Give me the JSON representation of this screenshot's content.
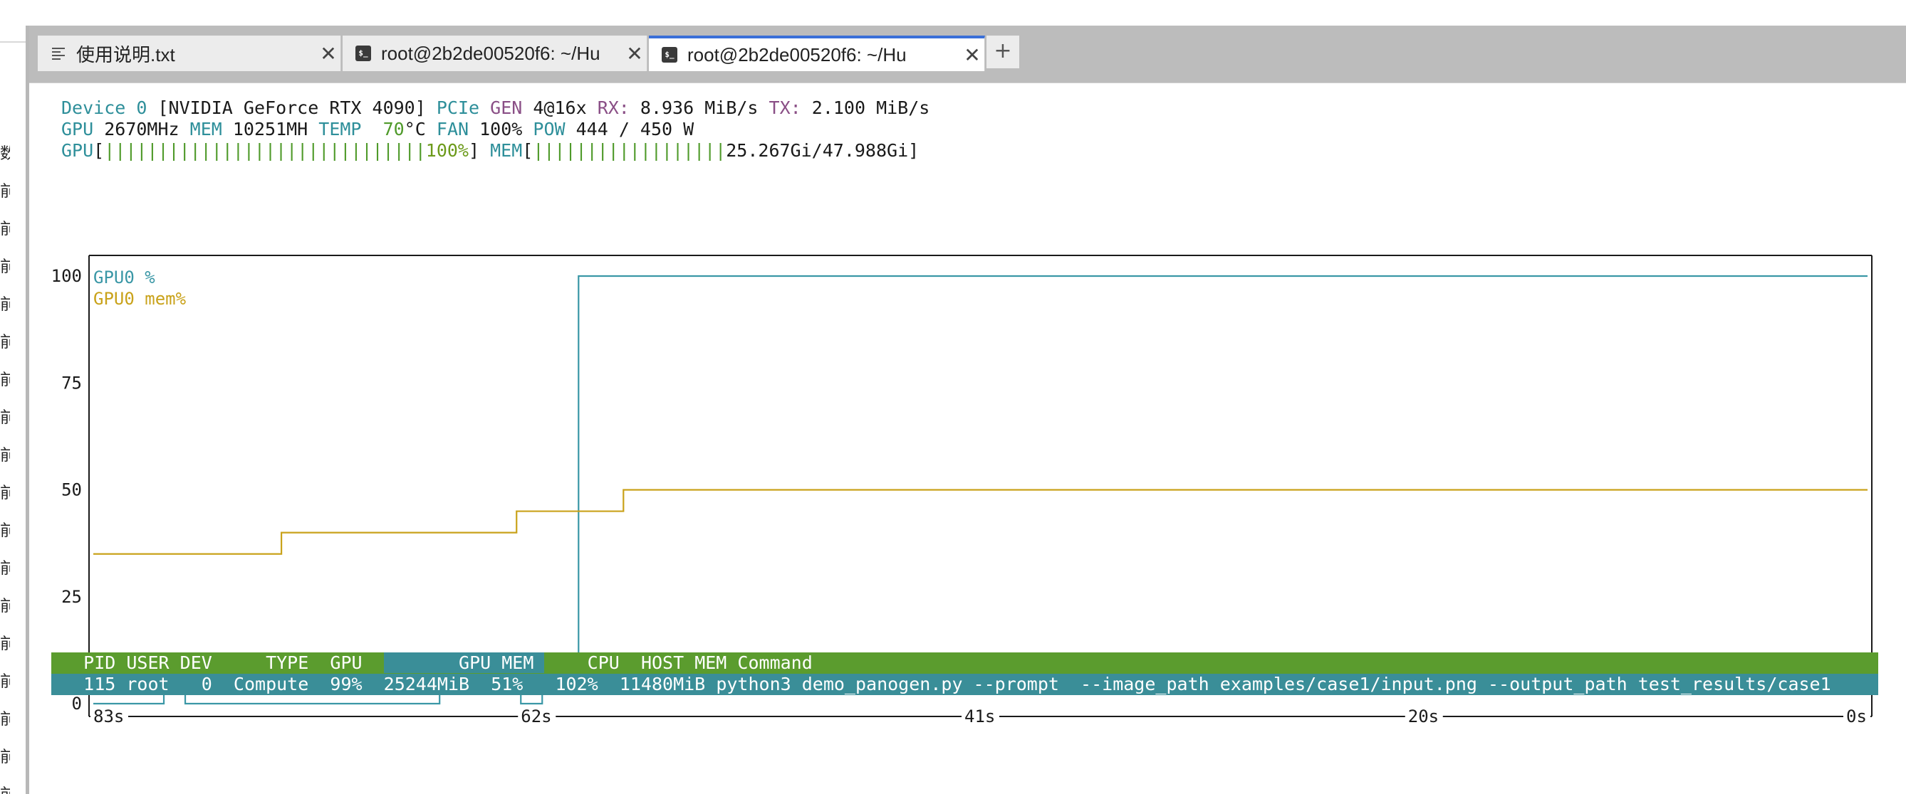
{
  "sidebar": {
    "glyphs": [
      "数",
      "前",
      "前",
      "前",
      "前",
      "前",
      "前",
      "前",
      "前",
      "前",
      "前",
      "前",
      "前",
      "前",
      "前",
      "前",
      "前",
      "前"
    ]
  },
  "tabs": [
    {
      "label": "使用说明.txt",
      "icon": "text-file-icon",
      "active": false
    },
    {
      "label": "root@2b2de00520f6: ~/Hu",
      "icon": "terminal-icon",
      "active": false
    },
    {
      "label": "root@2b2de00520f6: ~/Hu",
      "icon": "terminal-icon",
      "active": true
    }
  ],
  "tab_add_label": "+",
  "device": {
    "label": "Device",
    "index": "0",
    "name": "[NVIDIA GeForce RTX 4090]",
    "pcie_label": "PCIe",
    "gen_label": "GEN",
    "gen_value": "4@16x",
    "rx_label": "RX:",
    "rx_value": "8.936 MiB/s",
    "tx_label": "TX:",
    "tx_value": "2.100 MiB/s"
  },
  "stats": {
    "gpu_label": "GPU",
    "gpu_clock": "2670MHz",
    "mem_label": "MEM",
    "mem_clock": "10251MH",
    "temp_label": "TEMP",
    "temp_value": "70",
    "temp_unit": "°C",
    "fan_label": "FAN",
    "fan_value": "100%",
    "pow_label": "POW",
    "pow_value": "444 / 450 W"
  },
  "bars": {
    "gpu_label": "GPU",
    "gpu_bar": "||||||||||||||||||||||||||||||",
    "gpu_pct": "100%",
    "gpu_fill": 1.0,
    "mem_label": "MEM",
    "mem_bar": "||||||||||||||||||",
    "mem_value": "25.267Gi/47.988Gi",
    "mem_fill": 0.5265
  },
  "chart_data": {
    "type": "line",
    "x_ticks": [
      "83s",
      "62s",
      "41s",
      "20s",
      "0s"
    ],
    "xlim": [
      -83,
      0
    ],
    "y_ticks": [
      "100",
      "75",
      "50",
      "25",
      "0"
    ],
    "ylim": [
      0,
      100
    ],
    "series": [
      {
        "name": "GPU0 %",
        "color": "#3a97a6",
        "step": true,
        "x": [
          -83,
          -79.7,
          -78.7,
          -67.8,
          -66.8,
          -63.0,
          -62.0,
          -61.0,
          -60.3,
          -26.5,
          0
        ],
        "y": [
          0,
          5,
          0,
          0,
          5,
          0,
          5,
          10,
          100,
          100,
          100
        ]
      },
      {
        "name": "GPU0 mem%",
        "color": "#c9a21a",
        "step": true,
        "x": [
          -83,
          -74.2,
          -63.2,
          -58.2,
          0
        ],
        "y": [
          35,
          40,
          45,
          50,
          50
        ]
      }
    ]
  },
  "process": {
    "header": {
      "pid": "PID",
      "user": "USER",
      "dev": "DEV",
      "type": "TYPE",
      "gpu": "GPU",
      "gpu_mem": "GPU MEM",
      "cpu": "CPU",
      "host_mem": "HOST MEM",
      "command": "Command"
    },
    "rows": [
      {
        "pid": "115",
        "user": "root",
        "dev": "0",
        "type": "Compute",
        "gpu": "99%",
        "gpu_mem": "25244MiB",
        "gpu_mem_pct": "51%",
        "cpu": "102%",
        "host_mem": "11480MiB",
        "command": "python3 demo_panogen.py --prompt  --image_path examples/case1/input.png --output_path test_results/case1"
      }
    ]
  }
}
